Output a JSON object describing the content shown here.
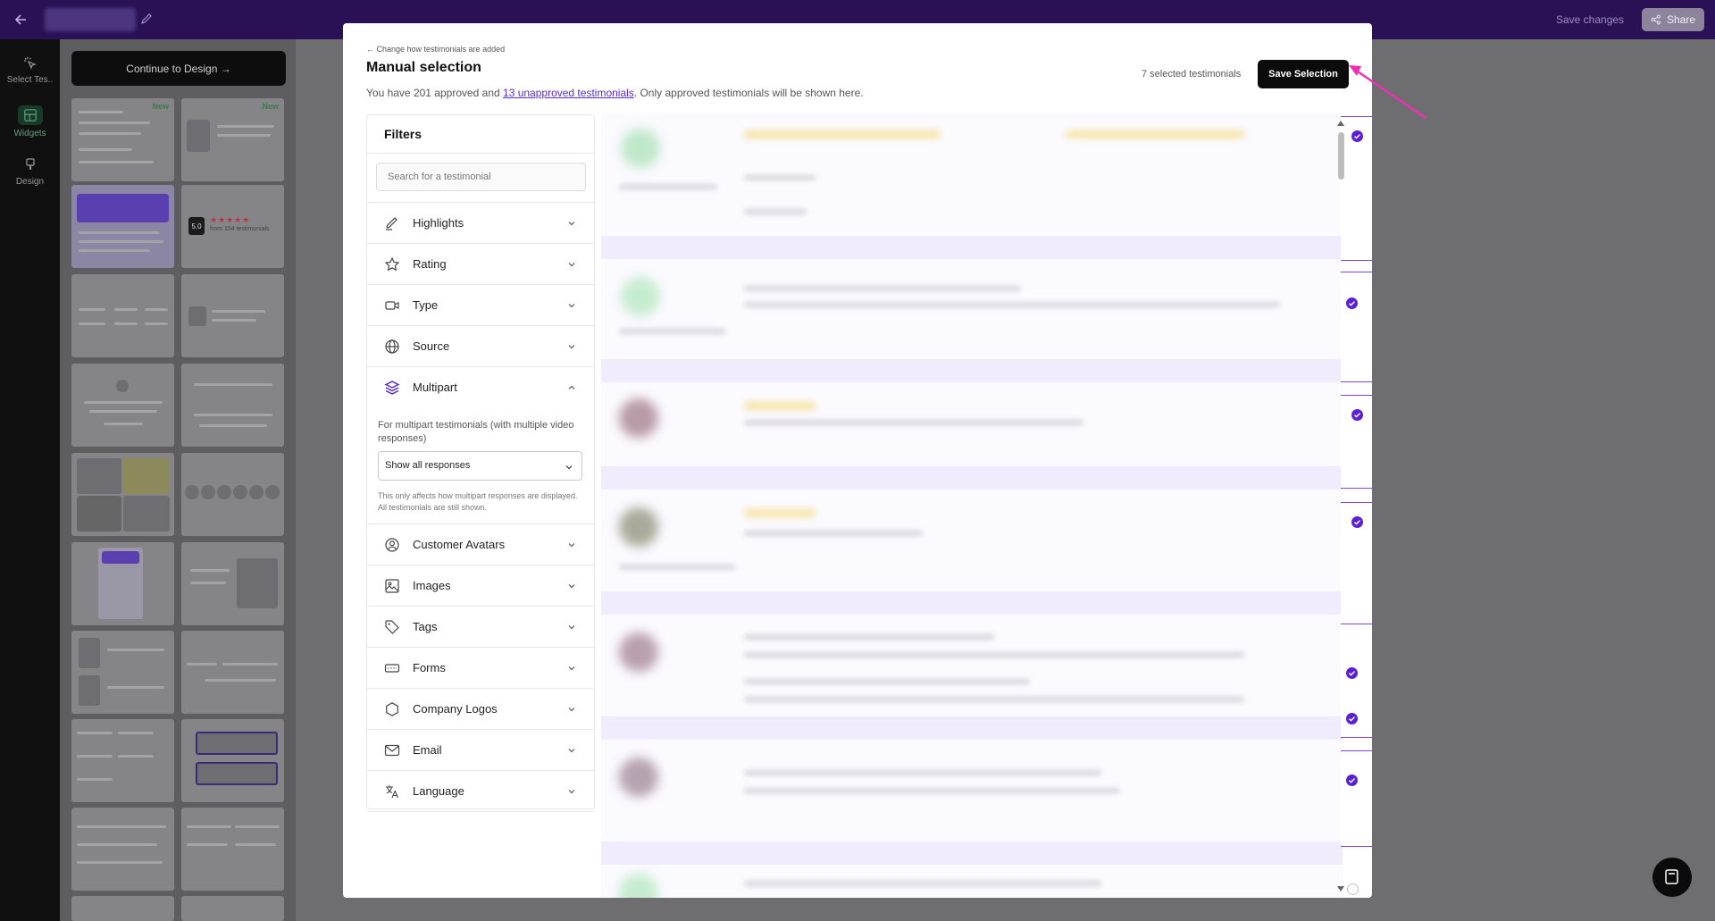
{
  "topbar": {
    "save_changes": "Save changes",
    "share": "Share"
  },
  "nav": {
    "items": [
      {
        "label": "Select Tes..",
        "icon": "pointer-click-icon"
      },
      {
        "label": "Widgets",
        "icon": "layout-grid-icon"
      },
      {
        "label": "Design",
        "icon": "paint-brush-icon"
      }
    ]
  },
  "panel": {
    "continue_label": "Continue to Design →",
    "new_badge": "New",
    "rating_value": "5.0",
    "rating_caption": "from 154 testimonials"
  },
  "modal": {
    "change_link": "← Change how testimonials are added",
    "title": "Manual selection",
    "subtitle_prefix": "You have 201 approved and ",
    "subtitle_link": "13 unapproved testimonials",
    "subtitle_suffix": ". Only approved testimonials will be shown here.",
    "selected_count": "7 selected testimonials",
    "save_selection": "Save Selection"
  },
  "filters": {
    "title": "Filters",
    "search_placeholder": "Search for a testimonial",
    "items_before": [
      {
        "label": "Highlights",
        "icon": "highlighter-icon"
      },
      {
        "label": "Rating",
        "icon": "star-icon"
      },
      {
        "label": "Type",
        "icon": "video-camera-icon"
      },
      {
        "label": "Source",
        "icon": "globe-icon"
      }
    ],
    "multipart": {
      "label": "Multipart",
      "description": "For multipart testimonials (with multiple video responses)",
      "select_value": "Show all responses",
      "note": "This only affects how multipart responses are displayed. All testimonials are still shown."
    },
    "items_after": [
      {
        "label": "Customer Avatars",
        "icon": "user-circle-icon"
      },
      {
        "label": "Images",
        "icon": "image-icon"
      },
      {
        "label": "Tags",
        "icon": "tag-icon"
      },
      {
        "label": "Forms",
        "icon": "form-icon"
      },
      {
        "label": "Company Logos",
        "icon": "hexagon-icon"
      },
      {
        "label": "Email",
        "icon": "mail-icon"
      },
      {
        "label": "Language",
        "icon": "translate-icon"
      }
    ]
  }
}
